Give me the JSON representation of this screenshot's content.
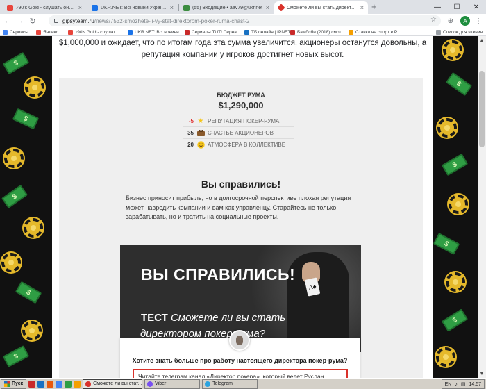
{
  "browser": {
    "tabs": [
      {
        "label": "♪90's Gold - слушать онлайн",
        "favicon_color": "#e8453c",
        "active": false
      },
      {
        "label": "UKR.NET: Всі новини України, оста",
        "favicon_color": "#1a73e8",
        "active": false
      },
      {
        "label": "(55) Входящие • aav79@ukr.net",
        "favicon_color": "#3c8d40",
        "active": false
      },
      {
        "label": "Сможете ли вы стать директором",
        "favicon_color": "#d9322b",
        "active": true
      }
    ],
    "new_tab_glyph": "+",
    "window_controls": [
      "—",
      "☐",
      "✕"
    ],
    "url_host": "gipsyteam.ru",
    "url_path": "/news/7532-smozhete-li-vy-stat-direktorom-poker-ruma-chast-2",
    "avatar_letter": "A",
    "bookmarks": [
      {
        "label": "Сервисы",
        "color": "#4285f4"
      },
      {
        "label": "Яндекс",
        "color": "#e8453c"
      },
      {
        "label": "♪90's Gold - слушат...",
        "color": "#e8453c"
      },
      {
        "label": "UKR.NET: Всі новинн...",
        "color": "#1a73e8"
      },
      {
        "label": "Сериалы TUT! Серна...",
        "color": "#c92a2a"
      },
      {
        "label": "TБ онлайн | IPNET",
        "color": "#1971c2"
      },
      {
        "label": "Бамблби (2018) смот...",
        "color": "#c92a2a"
      },
      {
        "label": "Ставки на спорт в Р...",
        "color": "#f59f00"
      }
    ],
    "reading_list": "Список для чтения"
  },
  "article": {
    "intro_line1": "$1,000,000 и ожидает, что по итогам года эта сумма увеличится, акционеры останутся довольны, а",
    "intro_line2": "репутация компании у игроков достигнет новых высот.",
    "budget_title": "БЮДЖЕТ РУМА",
    "budget_value": "$1,290,000",
    "stats": [
      {
        "value": "-5",
        "icon": "star-icon",
        "glyph": "★",
        "label": "РЕПУТАЦИЯ ПОКЕР-РУМА",
        "negative": true
      },
      {
        "value": "35",
        "icon": "briefcase-icon",
        "glyph": "💼",
        "label": "СЧАСТЬЕ АКЦИОНЕРОВ",
        "negative": false
      },
      {
        "value": "20",
        "icon": "smiley-icon",
        "glyph": "☺",
        "label": "АТМОСФЕРА В КОЛЛЕКТИВЕ",
        "negative": false
      }
    ],
    "result_title": "Вы справились!",
    "paragraph": "Бизнес приносит прибыль, но в долгосрочной перспективе плохая репутация может навредить компании и вам как управленцу. Старайтесь не только зарабатывать, но и тратить на социальные проекты.",
    "banner": {
      "headline": "ВЫ СПРАВИЛИСЬ!",
      "test_word": "ТЕСТ",
      "question_part1": "Сможете ли вы стать",
      "question_part2": "директором покер-рума?",
      "ace": "A♠"
    },
    "promo": {
      "question": "Хотите знать больше про работу настоящего директора покер-рума?",
      "box_text": "Читайте телеграм канал «Директор покера», который ведет Руслан"
    }
  },
  "taskbar": {
    "start": "Пуск",
    "tasks": [
      {
        "label": "Сможете ли вы стат...",
        "color": "#d9322b",
        "active": true
      },
      {
        "label": "Viber",
        "color": "#7950f2",
        "active": false
      },
      {
        "label": "Telegram",
        "color": "#2aa3e0",
        "active": false
      }
    ],
    "lang": "EN",
    "time": "14:57"
  },
  "colors": {
    "accent_red": "#d9322b",
    "negative": "#e03131",
    "card_bg": "#efefef",
    "side_bg": "#111111"
  }
}
